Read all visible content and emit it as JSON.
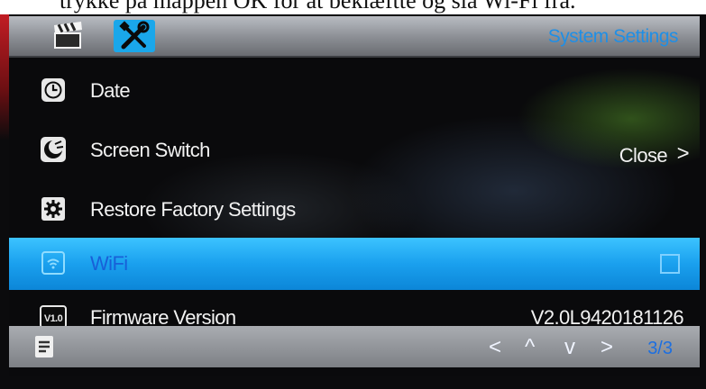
{
  "caption": "trykke på mappen OK for at beklæftte og slå Wi-Fi fra.",
  "header": {
    "tabs": [
      {
        "icon": "video-clapper-icon"
      },
      {
        "icon": "tools-icon",
        "selected": true
      }
    ],
    "title": "System Settings"
  },
  "menu": {
    "items": [
      {
        "icon": "clock-icon",
        "label": "Date",
        "value": ""
      },
      {
        "icon": "screen-switch-icon",
        "label": "Screen Switch",
        "value": "Close"
      },
      {
        "icon": "gear-icon",
        "label": "Restore Factory Settings",
        "value": ""
      },
      {
        "icon": "wifi-icon",
        "label": "WiFi",
        "value": "",
        "selected": true,
        "checked": false
      },
      {
        "icon": "version-badge-icon",
        "label": "Firmware Version",
        "value": "V2.0L9420181126",
        "badge": "V1.0"
      }
    ]
  },
  "footer": {
    "nav": {
      "left": "<",
      "up": "^",
      "down": "v",
      "right": ">"
    },
    "page": "3/3"
  },
  "colors": {
    "accent": "#1aa7ea",
    "title": "#1f8fe6",
    "selected_text": "#1860d8",
    "page_indicator": "#1d6fe0"
  }
}
